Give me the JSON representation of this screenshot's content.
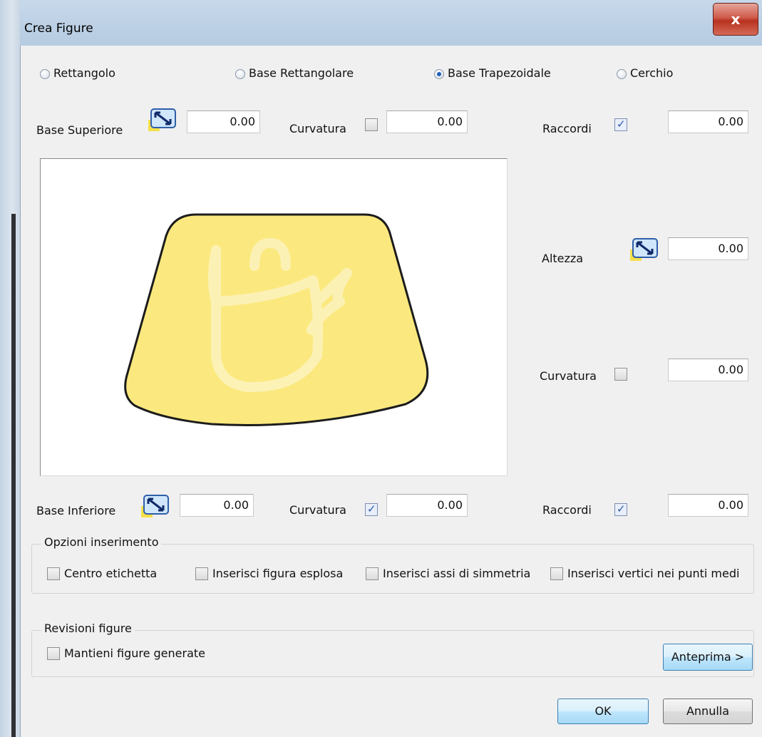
{
  "window": {
    "title": "Crea Figure",
    "close_label": "x"
  },
  "shape_types": [
    {
      "label": "Rettangolo",
      "selected": false
    },
    {
      "label": "Base Rettangolare",
      "selected": false
    },
    {
      "label": "Base Trapezoidale",
      "selected": true
    },
    {
      "label": "Cerchio",
      "selected": false
    }
  ],
  "top_row": {
    "base_superiore_label": "Base Superiore",
    "base_superiore_value": "0.00",
    "curvatura_label": "Curvatura",
    "curvatura_checked": false,
    "curvatura_value": "0.00",
    "raccordi_label": "Raccordi",
    "raccordi_checked": true,
    "raccordi_value": "0.00"
  },
  "right_column": {
    "altezza_label": "Altezza",
    "altezza_value": "0.00",
    "curvatura_label": "Curvatura",
    "curvatura_checked": false,
    "curvatura_value": "0.00"
  },
  "bottom_row": {
    "base_inferiore_label": "Base Inferiore",
    "base_inferiore_value": "0.00",
    "curvatura_label": "Curvatura",
    "curvatura_checked": true,
    "curvatura_value": "0.00",
    "raccordi_label": "Raccordi",
    "raccordi_checked": true,
    "raccordi_value": "0.00"
  },
  "preview": {
    "fill_color": "#fbe97f",
    "stroke_color": "#1c1c1c"
  },
  "insert_options": {
    "title": "Opzioni inserimento",
    "items": [
      {
        "label": "Centro etichetta",
        "checked": false
      },
      {
        "label": "Inserisci figura esplosa",
        "checked": false
      },
      {
        "label": "Inserisci assi di simmetria",
        "checked": false
      },
      {
        "label": "Inserisci vertici nei punti medi",
        "checked": false
      }
    ]
  },
  "revisions": {
    "title": "Revisioni figure",
    "keep_label": "Mantieni figure generate",
    "keep_checked": false,
    "preview_button": "Anteprima >"
  },
  "footer": {
    "ok_label": "OK",
    "cancel_label": "Annulla"
  }
}
